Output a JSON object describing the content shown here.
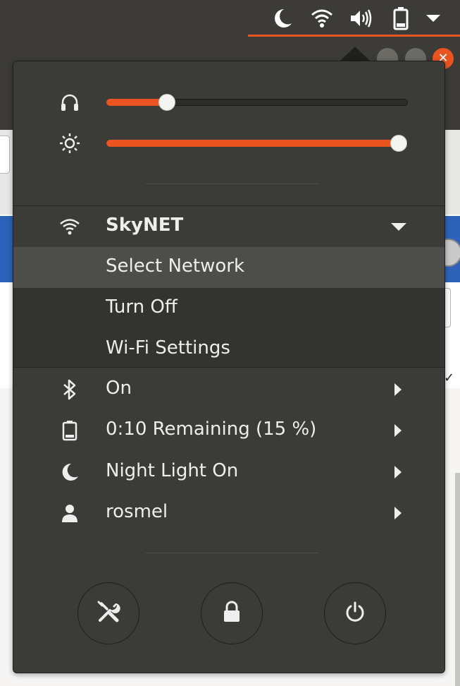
{
  "top_panel": {
    "indicators": [
      {
        "icon": "night-light-icon"
      },
      {
        "icon": "wifi-icon"
      },
      {
        "icon": "volume-icon"
      },
      {
        "icon": "battery-icon"
      },
      {
        "icon": "dropdown-arrow-icon"
      }
    ],
    "accent_color": "#e95420"
  },
  "menu": {
    "volume": {
      "icon": "headphones-icon",
      "level_percent": 20
    },
    "brightness": {
      "icon": "brightness-icon",
      "level_percent": 97
    },
    "wifi": {
      "icon": "wifi-icon",
      "network_name": "SkyNET",
      "items": [
        {
          "label": "Select Network",
          "highlighted": true
        },
        {
          "label": "Turn Off",
          "highlighted": false
        },
        {
          "label": "Wi-Fi Settings",
          "highlighted": false
        }
      ]
    },
    "bluetooth": {
      "icon": "bluetooth-icon",
      "label": "On"
    },
    "battery": {
      "icon": "battery-icon",
      "label": "0:10 Remaining (15 %)"
    },
    "night_light": {
      "icon": "night-light-icon",
      "label": "Night Light On"
    },
    "user": {
      "icon": "user-icon",
      "label": "rosmel"
    },
    "actions": [
      {
        "icon": "settings-icon",
        "name": "settings"
      },
      {
        "icon": "lock-icon",
        "name": "lock"
      },
      {
        "icon": "power-icon",
        "name": "power"
      }
    ]
  },
  "colors": {
    "panel_bg": "#3c3b37",
    "menu_bg": "#3b3b38",
    "accent": "#e95420",
    "text": "#eeeeec"
  }
}
